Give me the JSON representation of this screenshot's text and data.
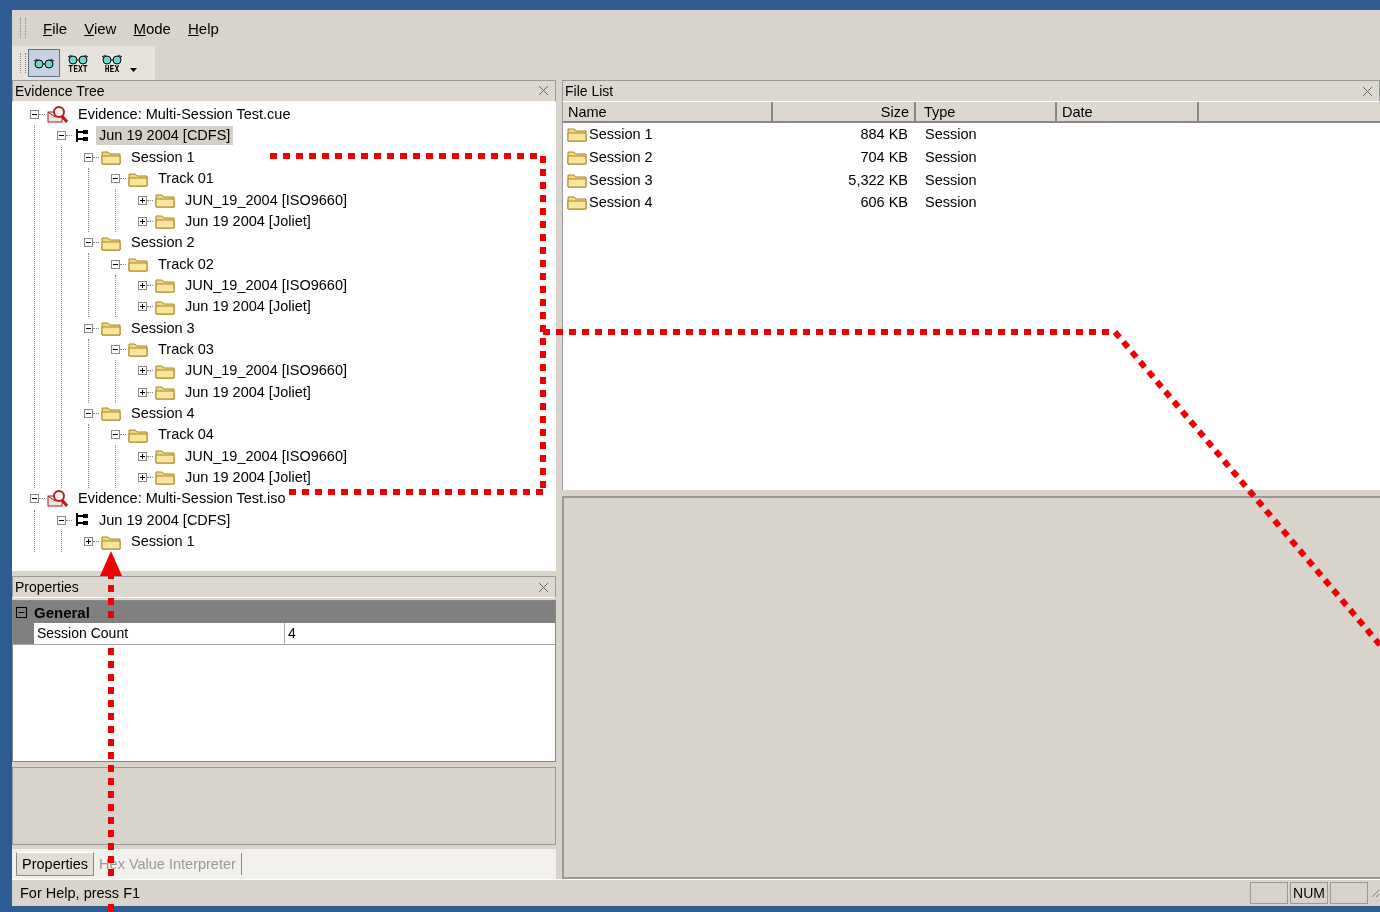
{
  "menu": [
    {
      "label": "File"
    },
    {
      "label": "View"
    },
    {
      "label": "Mode"
    },
    {
      "label": "Help"
    }
  ],
  "toolbar": [
    {
      "kind": "plain",
      "selected": true
    },
    {
      "kind": "labeled",
      "label": "TEXT",
      "selected": false
    },
    {
      "kind": "labeled",
      "label": "HEX",
      "selected": false
    }
  ],
  "evidence_tree": {
    "title": "Evidence Tree",
    "nodes": [
      {
        "kind": "evidence",
        "label": "Evidence: Multi-Session Test.cue",
        "expanded": true,
        "selected": false,
        "children": [
          {
            "kind": "volume",
            "label": "Jun 19 2004 [CDFS]",
            "expanded": true,
            "selected": true,
            "children": [
              {
                "kind": "folder",
                "label": "Session 1",
                "expanded": true,
                "selected": false,
                "children": [
                  {
                    "kind": "folder",
                    "label": "Track 01",
                    "expanded": true,
                    "selected": false,
                    "children": [
                      {
                        "kind": "folder",
                        "label": "JUN_19_2004 [ISO9660]",
                        "expanded": false,
                        "selected": false
                      },
                      {
                        "kind": "folder",
                        "label": "Jun 19 2004 [Joliet]",
                        "expanded": false,
                        "selected": false
                      }
                    ]
                  }
                ]
              },
              {
                "kind": "folder",
                "label": "Session 2",
                "expanded": true,
                "selected": false,
                "children": [
                  {
                    "kind": "folder",
                    "label": "Track 02",
                    "expanded": true,
                    "selected": false,
                    "children": [
                      {
                        "kind": "folder",
                        "label": "JUN_19_2004 [ISO9660]",
                        "expanded": false,
                        "selected": false
                      },
                      {
                        "kind": "folder",
                        "label": "Jun 19 2004 [Joliet]",
                        "expanded": false,
                        "selected": false
                      }
                    ]
                  }
                ]
              },
              {
                "kind": "folder",
                "label": "Session 3",
                "expanded": true,
                "selected": false,
                "children": [
                  {
                    "kind": "folder",
                    "label": "Track 03",
                    "expanded": true,
                    "selected": false,
                    "children": [
                      {
                        "kind": "folder",
                        "label": "JUN_19_2004 [ISO9660]",
                        "expanded": false,
                        "selected": false
                      },
                      {
                        "kind": "folder",
                        "label": "Jun 19 2004 [Joliet]",
                        "expanded": false,
                        "selected": false
                      }
                    ]
                  }
                ]
              },
              {
                "kind": "folder",
                "label": "Session 4",
                "expanded": true,
                "selected": false,
                "children": [
                  {
                    "kind": "folder",
                    "label": "Track 04",
                    "expanded": true,
                    "selected": false,
                    "children": [
                      {
                        "kind": "folder",
                        "label": "JUN_19_2004 [ISO9660]",
                        "expanded": false,
                        "selected": false
                      },
                      {
                        "kind": "folder",
                        "label": "Jun 19 2004 [Joliet]",
                        "expanded": false,
                        "selected": false
                      }
                    ]
                  }
                ]
              }
            ]
          }
        ]
      },
      {
        "kind": "evidence",
        "label": "Evidence: Multi-Session Test.iso",
        "expanded": true,
        "selected": false,
        "children": [
          {
            "kind": "volume",
            "label": "Jun 19 2004 [CDFS]",
            "expanded": true,
            "selected": false,
            "children": [
              {
                "kind": "folder",
                "label": "Session 1",
                "expanded": false,
                "selected": false
              }
            ]
          }
        ]
      }
    ]
  },
  "properties": {
    "title": "Properties",
    "group": {
      "label": "General",
      "expanded": true
    },
    "rows": [
      {
        "name": "Session Count",
        "value": "4"
      }
    ]
  },
  "bottom_tabs": [
    {
      "label": "Properties",
      "selected": true
    },
    {
      "label": "Hex Value Interpreter",
      "selected": false
    }
  ],
  "file_list": {
    "title": "File List",
    "columns": [
      "Name",
      "Size",
      "Type",
      "Date"
    ],
    "rows": [
      {
        "name": "Session 1",
        "size": "884 KB",
        "type": "Session"
      },
      {
        "name": "Session 2",
        "size": "704 KB",
        "type": "Session"
      },
      {
        "name": "Session 3",
        "size": "5,322 KB",
        "type": "Session"
      },
      {
        "name": "Session 4",
        "size": "606 KB",
        "type": "Session"
      }
    ]
  },
  "status_bar": {
    "text": "For Help, press F1",
    "indicator": "NUM"
  }
}
